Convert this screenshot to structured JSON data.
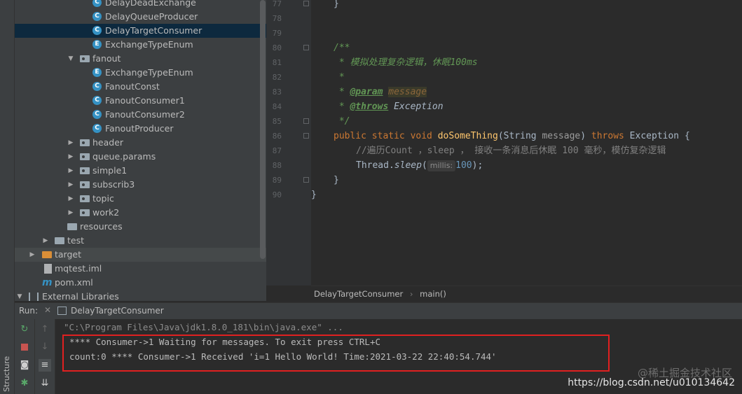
{
  "project_tree": [
    {
      "label": "DelayDeadExchange",
      "type": "class"
    },
    {
      "label": "DelayQueueProducer",
      "type": "class"
    },
    {
      "label": "DelayTargetConsumer",
      "type": "class",
      "selected": true
    },
    {
      "label": "ExchangeTypeEnum",
      "type": "enum"
    },
    {
      "label": "fanout",
      "type": "package",
      "expanded": true
    },
    {
      "label": "ExchangeTypeEnum",
      "type": "enum"
    },
    {
      "label": "FanoutConst",
      "type": "class"
    },
    {
      "label": "FanoutConsumer1",
      "type": "class"
    },
    {
      "label": "FanoutConsumer2",
      "type": "class"
    },
    {
      "label": "FanoutProducer",
      "type": "class"
    },
    {
      "label": "header",
      "type": "package"
    },
    {
      "label": "queue.params",
      "type": "package"
    },
    {
      "label": "simple1",
      "type": "package"
    },
    {
      "label": "subscrib3",
      "type": "package"
    },
    {
      "label": "topic",
      "type": "package"
    },
    {
      "label": "work2",
      "type": "package"
    },
    {
      "label": "resources",
      "type": "resources"
    },
    {
      "label": "test",
      "type": "folder"
    },
    {
      "label": "target",
      "type": "folder-orange"
    },
    {
      "label": "mqtest.iml",
      "type": "file"
    },
    {
      "label": "pom.xml",
      "type": "maven"
    },
    {
      "label": "External Libraries",
      "type": "libs"
    }
  ],
  "editor": {
    "line_numbers": [
      "77",
      "78",
      "79",
      "80",
      "81",
      "82",
      "83",
      "84",
      "85",
      "86",
      "87",
      "88",
      "89",
      "90"
    ],
    "code": {
      "l77": "}",
      "l80": "/**",
      "l81": " * 模拟处理复杂逻辑，休眠100ms",
      "l82": " *",
      "l83_star": " * ",
      "l83_tag": "@param",
      "l83_name": "message",
      "l84_star": " * ",
      "l84_tag": "@throws",
      "l84_rest": " Exception",
      "l85": " */",
      "l86_kw": "public static void ",
      "l86_fn": "doSomeThing",
      "l86_p1": "(String ",
      "l86_p2": "message",
      "l86_p3": ") ",
      "l86_kw2": "throws",
      "l86_p4": " Exception {",
      "l87": "//遍历Count ，sleep ， 接收一条消息后休眠 100 毫秒，模仿复杂逻辑",
      "l88_a": "Thread.",
      "l88_b": "sleep",
      "l88_c": "(",
      "l88_hint": "millis:",
      "l88_num": "100",
      "l88_d": ");",
      "l89": "}",
      "l90": "}"
    }
  },
  "breadcrumb": {
    "class": "DelayTargetConsumer",
    "method": "main()"
  },
  "run": {
    "label": "Run:",
    "tab": "DelayTargetConsumer",
    "console": [
      "\"C:\\Program Files\\Java\\jdk1.8.0_181\\bin\\java.exe\" ...",
      "**** Consumer->1 Waiting for messages. To exit press CTRL+C",
      "count:0 **** Consumer->1 Received 'i=1 Hello World! Time:2021-03-22 22:40:54.744'"
    ]
  },
  "side_tab": "Structure",
  "watermark": "https://blog.csdn.net/u010134642",
  "watermark2": "@稀土掘金技术社区"
}
